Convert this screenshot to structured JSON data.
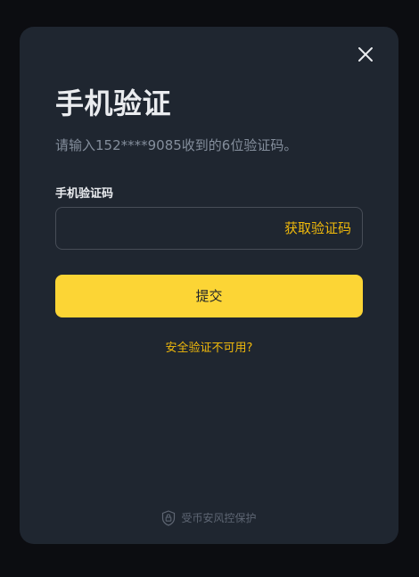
{
  "modal": {
    "title": "手机验证",
    "subtitle": "请输入152****9085收到的6位验证码。",
    "field_label": "手机验证码",
    "input": {
      "value": "",
      "placeholder": ""
    },
    "get_code_label": "获取验证码",
    "submit_label": "提交",
    "security_link": "安全验证不可用?",
    "footer_text": "受币安风控保护",
    "icons": {
      "close": "close-icon",
      "footer": "shield-lock-icon"
    }
  },
  "colors": {
    "page_background": "#0c0d11",
    "modal_background": "#1f2630",
    "accent": "#fcd535",
    "link": "#f0b90b",
    "text_primary": "#eaecef",
    "text_secondary": "#848e9c",
    "input_border": "#474d57"
  }
}
